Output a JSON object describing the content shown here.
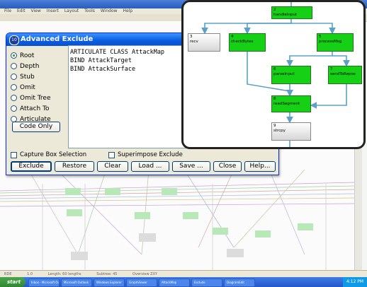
{
  "background": {
    "menu": [
      "File",
      "Edit",
      "View",
      "Insert",
      "Layout",
      "Tools",
      "Window",
      "Help"
    ],
    "status": [
      "RDE",
      "1.0",
      "Length: 60 lengths",
      "Subtree: 45",
      "Overview ZXY"
    ],
    "canvas_nodes": 24
  },
  "taskbar": {
    "start_label": "start",
    "items": [
      "Inbox - Microsoft Out...",
      "Microsoft Outlook",
      "Windows Explorer",
      "GraphViewer",
      "AttackMap",
      "Exclude",
      "DiagramEdit"
    ],
    "tray_time": "4:12 PM"
  },
  "dialog": {
    "title": "Advanced Exclude",
    "options": [
      {
        "label": "Root",
        "selected": true
      },
      {
        "label": "Depth",
        "selected": false
      },
      {
        "label": "Stub",
        "selected": false
      },
      {
        "label": "Omit",
        "selected": false
      },
      {
        "label": "Omit Tree",
        "selected": false
      },
      {
        "label": "Attach To",
        "selected": false
      },
      {
        "label": "Articulate",
        "selected": false
      }
    ],
    "code_only_label": "Code Only",
    "code_lines": [
      "ARTICULATE CLASS AttackMap",
      "BIND AttackTarget",
      "BIND AttackSurface"
    ],
    "capture_box_label": "Capture Box Selection",
    "superimpose_label": "Superimpose Exclude",
    "buttons": [
      "Exclude",
      "Restore",
      "Clear",
      "Load ...",
      "Save ...",
      "Close",
      "Help..."
    ]
  },
  "graph": {
    "nodes": [
      {
        "id": "2",
        "label": "handleInput",
        "style": "green"
      },
      {
        "id": "3",
        "label": "recv",
        "style": "gray"
      },
      {
        "id": "4",
        "label": "checkBytes",
        "style": "green"
      },
      {
        "id": "5",
        "label": "processMsg",
        "style": "green"
      },
      {
        "id": "6",
        "label": "parseInput",
        "style": "green"
      },
      {
        "id": "7",
        "label": "sendToRepos",
        "style": "green"
      },
      {
        "id": "8",
        "label": "readSegment",
        "style": "green"
      },
      {
        "id": "9",
        "label": "strcpy",
        "style": "gray"
      }
    ],
    "colors": {
      "node_green": "#16d016",
      "edge": "#5aa0c8",
      "edge_dark": "#4a7fb0"
    }
  }
}
